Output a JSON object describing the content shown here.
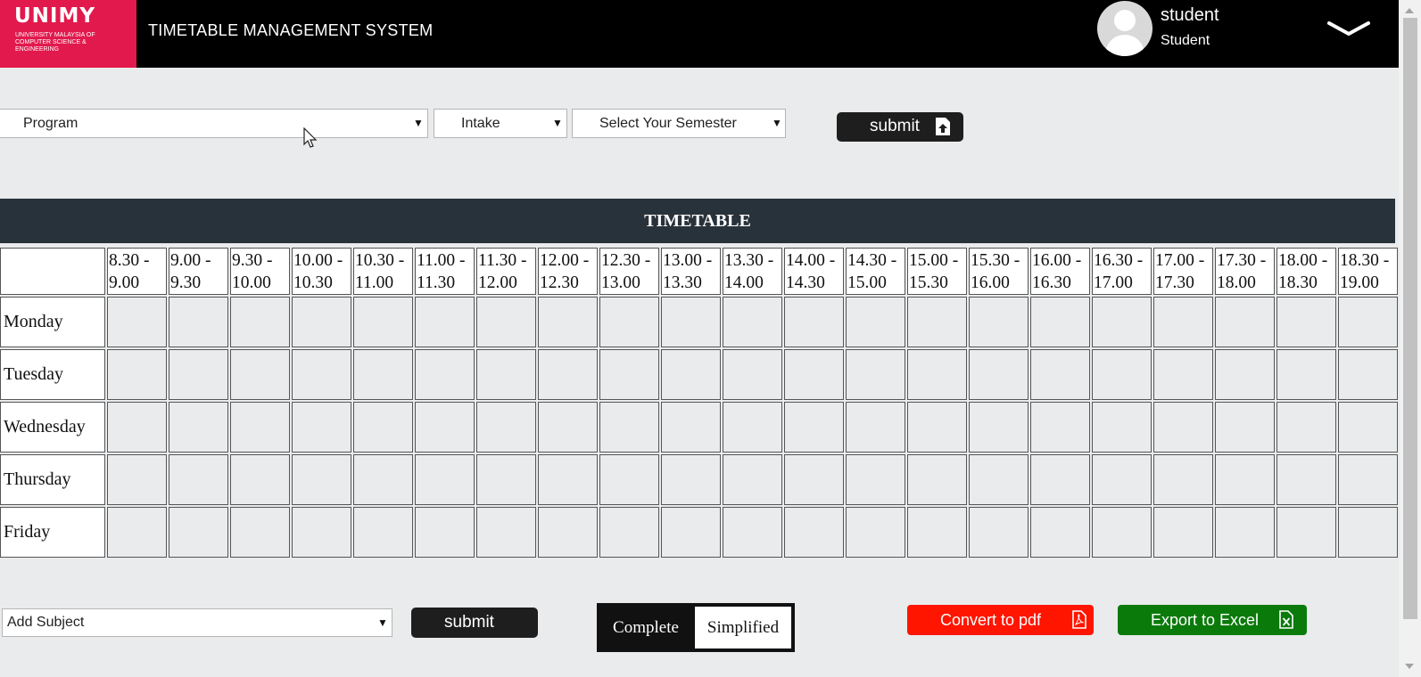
{
  "header": {
    "logo_big": "UNIMY",
    "logo_small": "UNIVERSITY MALAYSIA OF COMPUTER SCIENCE & ENGINEERING",
    "title": "TIMETABLE MANAGEMENT SYSTEM",
    "user_name": "student",
    "user_role": "Student"
  },
  "filters": {
    "program": "Program",
    "intake": "Intake",
    "semester": "Select Your Semester",
    "submit_label": "submit"
  },
  "timetable": {
    "title": "TIMETABLE",
    "time_slots": [
      "8.30 - 9.00",
      "9.00 - 9.30",
      "9.30 - 10.00",
      "10.00 - 10.30",
      "10.30 - 11.00",
      "11.00 - 11.30",
      "11.30 - 12.00",
      "12.00 - 12.30",
      "12.30 - 13.00",
      "13.00 - 13.30",
      "13.30 - 14.00",
      "14.00 - 14.30",
      "14.30 - 15.00",
      "15.00 - 15.30",
      "15.30 - 16.00",
      "16.00 - 16.30",
      "16.30 - 17.00",
      "17.00 - 17.30",
      "17.30 - 18.00",
      "18.00 - 18.30",
      "18.30 - 19.00"
    ],
    "days": [
      "Monday",
      "Tuesday",
      "Wednesday",
      "Thursday",
      "Friday"
    ]
  },
  "footer": {
    "add_subject": "Add Subject",
    "submit_label": "submit",
    "mode_complete": "Complete",
    "mode_simplified": "Simplified",
    "convert_pdf": "Convert to pdf",
    "export_excel": "Export to Excel"
  },
  "colors": {
    "brand": "#e2194d",
    "header_bg": "#000000",
    "timetable_header": "#28323a",
    "pdf_button": "#ff1500",
    "excel_button": "#0a7a0a"
  }
}
